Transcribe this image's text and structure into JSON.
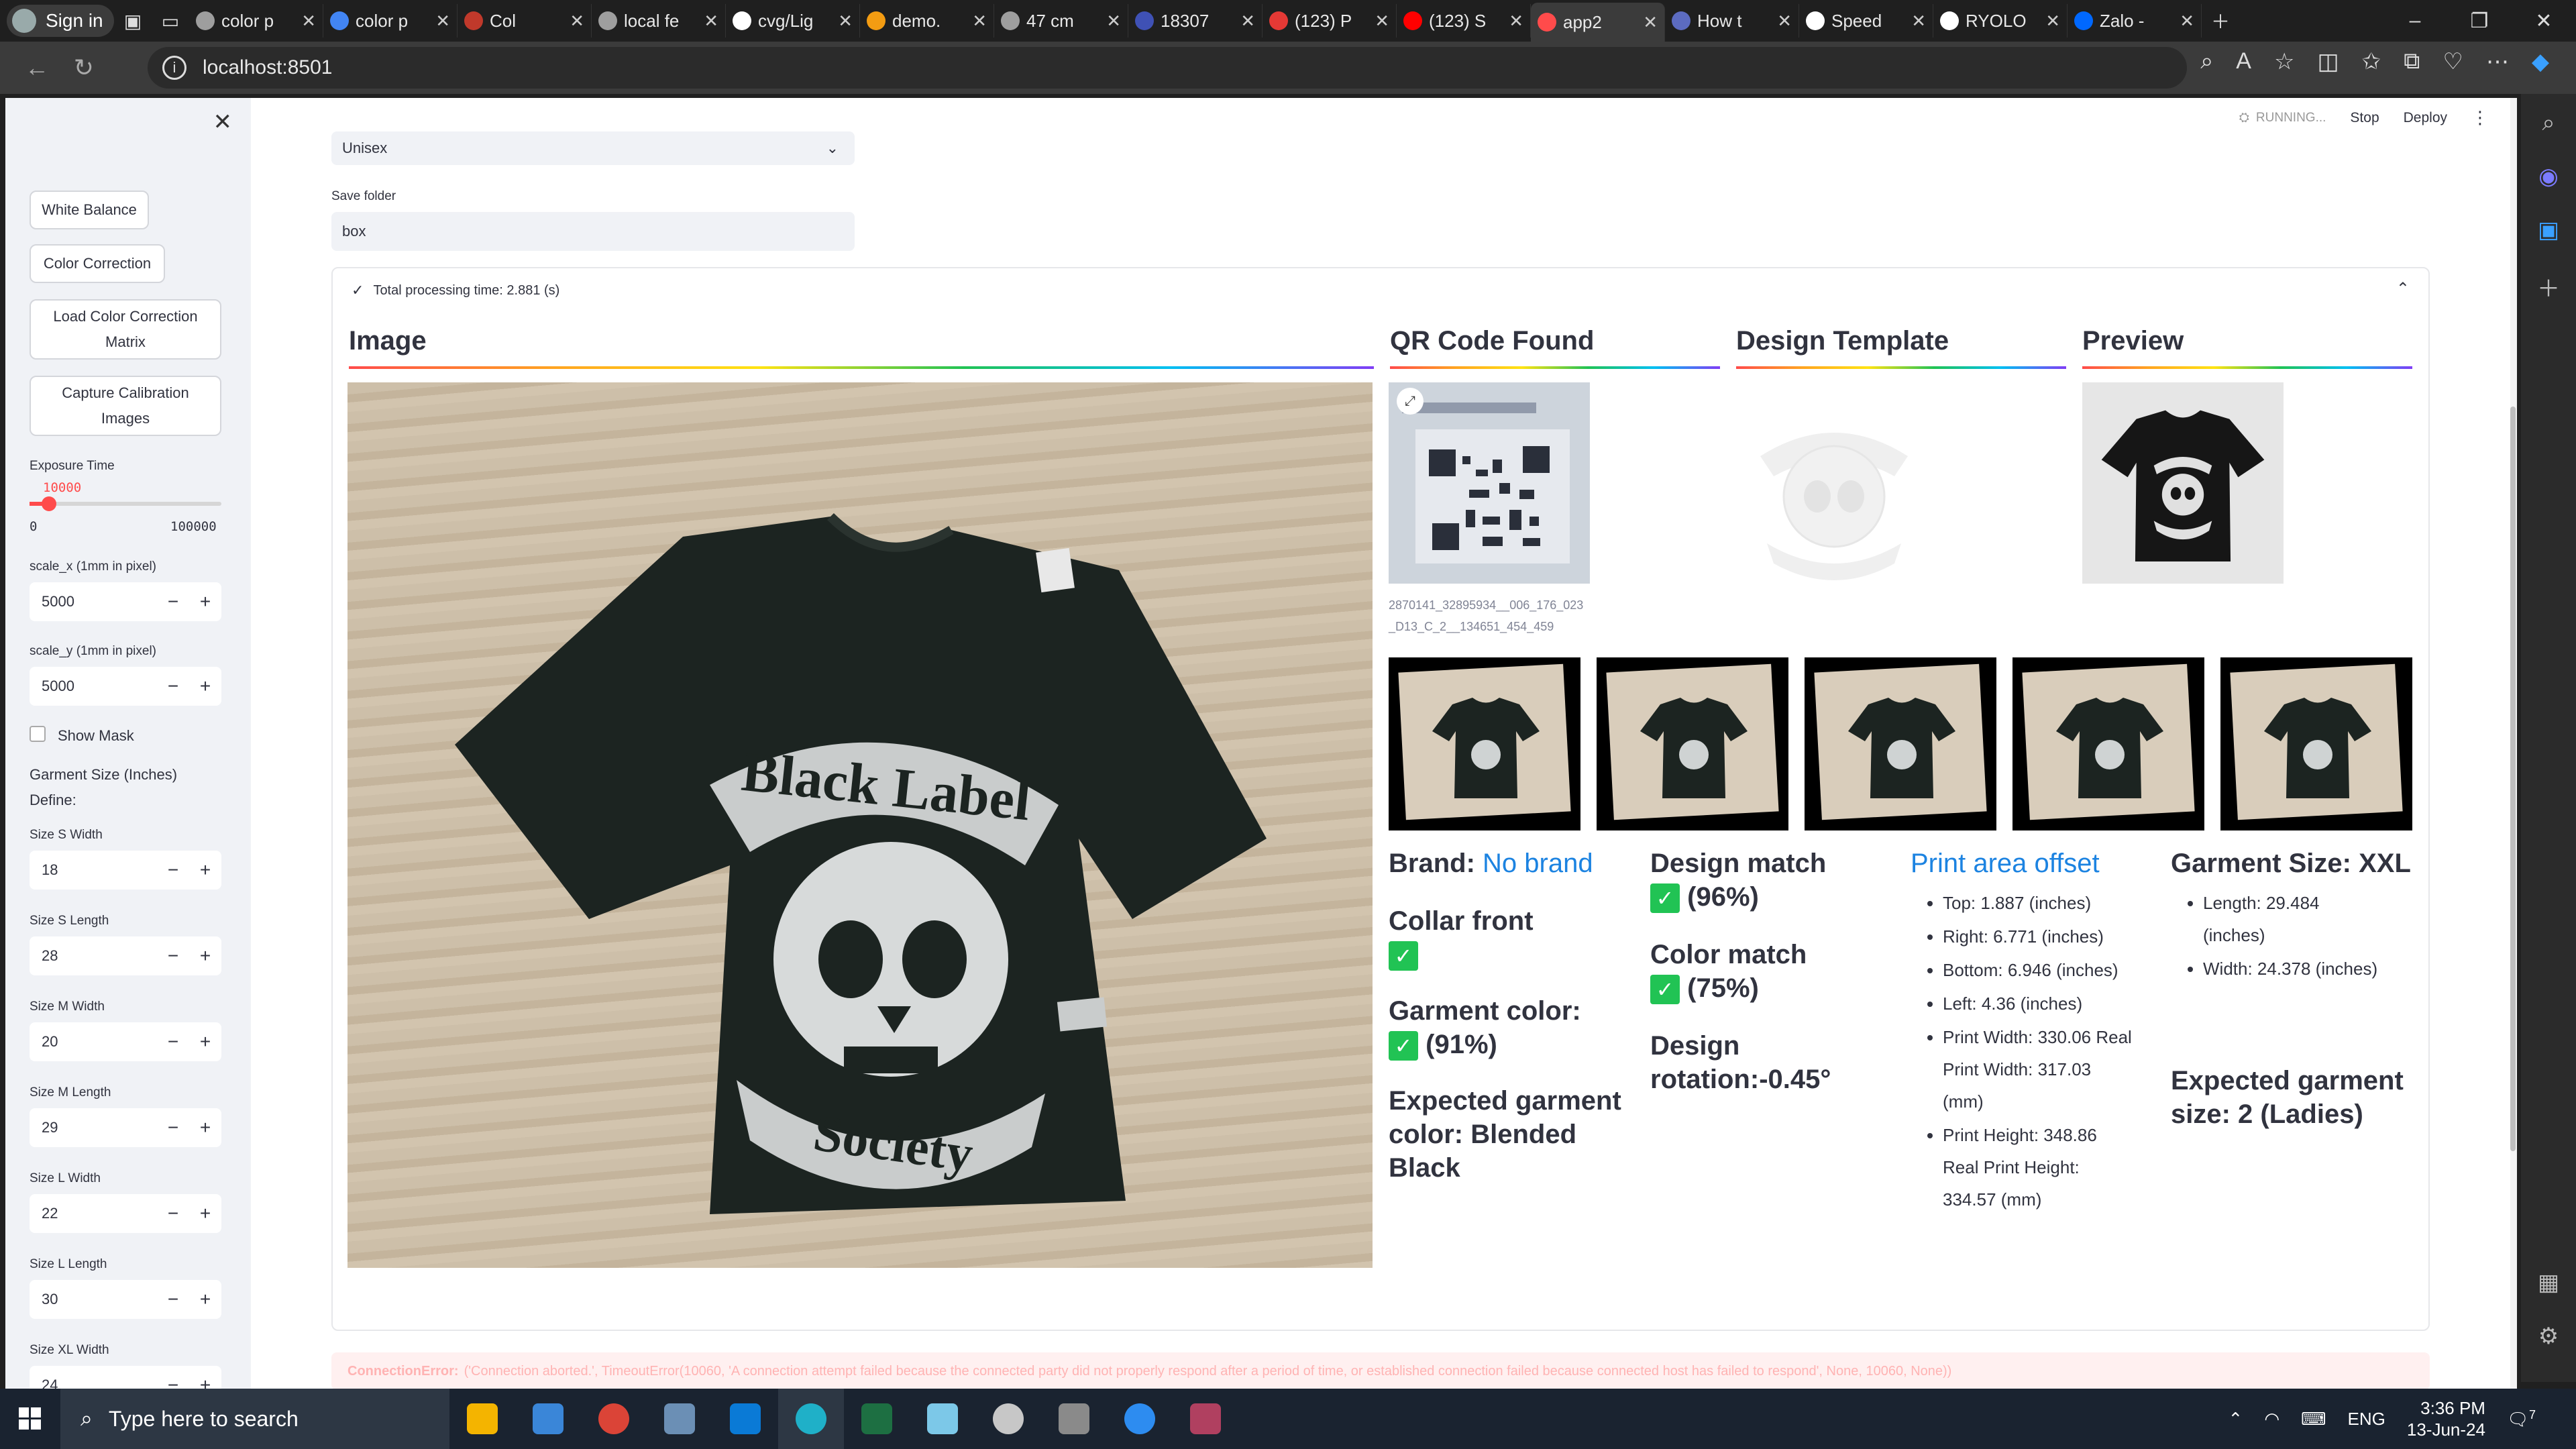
{
  "browser": {
    "profile_label": "Sign in",
    "tabs": [
      {
        "title": "color p",
        "color": "#9e9e9e"
      },
      {
        "title": "color p",
        "color": "#4285f4"
      },
      {
        "title": "Col",
        "color": "#c0392b"
      },
      {
        "title": "local fe",
        "color": "#9e9e9e"
      },
      {
        "title": "cvg/Lig",
        "color": "#ffffff"
      },
      {
        "title": "demo.",
        "color": "#f39c12"
      },
      {
        "title": "47 cm",
        "color": "#9e9e9e"
      },
      {
        "title": "18307",
        "color": "#3f51b5"
      },
      {
        "title": "(123) P",
        "color": "#e53935"
      },
      {
        "title": "(123) S",
        "color": "#ff0000"
      },
      {
        "title": "app2",
        "color": "#ff4b4b"
      },
      {
        "title": "How t",
        "color": "#5c6bc0"
      },
      {
        "title": "Speed",
        "color": "#ffffff"
      },
      {
        "title": "RYOLO",
        "color": "#ffffff"
      },
      {
        "title": "Zalo -",
        "color": "#0068ff"
      }
    ],
    "active_tab_index": 10,
    "url": "localhost:8501"
  },
  "sidebar": {
    "buttons": {
      "white_balance": "White Balance",
      "color_correction": "Color Correction",
      "load_ccm": "Load Color Correction Matrix",
      "capture_calib": "Capture Calibration Images"
    },
    "exposure": {
      "label": "Exposure Time",
      "value": "10000",
      "min": "0",
      "max": "100000",
      "fraction": 0.1
    },
    "scale_x": {
      "label": "scale_x (1mm in pixel)",
      "value": "5000"
    },
    "scale_y": {
      "label": "scale_y (1mm in pixel)",
      "value": "5000"
    },
    "show_mask": "Show Mask",
    "garment_size_heading": "Garment Size (Inches)",
    "define_label": "Define:",
    "sizes": [
      {
        "label": "Size S Width",
        "value": "18"
      },
      {
        "label": "Size S Length",
        "value": "28"
      },
      {
        "label": "Size M Width",
        "value": "20"
      },
      {
        "label": "Size M Length",
        "value": "29"
      },
      {
        "label": "Size L Width",
        "value": "22"
      },
      {
        "label": "Size L Length",
        "value": "30"
      },
      {
        "label": "Size XL Width",
        "value": "24"
      }
    ]
  },
  "header": {
    "running": "RUNNING...",
    "stop": "Stop",
    "deploy": "Deploy"
  },
  "main": {
    "gender_value": "Unisex",
    "save_folder_label": "Save folder",
    "save_folder_value": "box",
    "expander_title": "Total processing time: 2.881 (s)",
    "col_titles": {
      "image": "Image",
      "qr": "QR Code Found",
      "template": "Design Template",
      "preview": "Preview"
    },
    "qr_caption": "2870141_32895934__006_176_023_D13_C_2__134651_454_459",
    "brand_label": "Brand:",
    "brand_value": "No brand",
    "collar": "Collar front",
    "garment_color_label": "Garment color:",
    "garment_color_pct": "(91%)",
    "expected_color": "Expected garment color: Blended Black",
    "design_match_label": "Design match",
    "design_match_pct": "(96%)",
    "color_match_label": "Color match",
    "color_match_pct": "(75%)",
    "design_rotation": "Design rotation:-0.45°",
    "print_area_title": "Print area offset",
    "print_area": [
      "Top: 1.887 (inches)",
      "Right: 6.771 (inches)",
      "Bottom: 6.946 (inches)",
      "Left: 4.36 (inches)",
      "Print Width: 330.06 Real Print Width: 317.03 (mm)",
      "Print Height: 348.86 Real Print Height: 334.57 (mm)"
    ],
    "garment_size_title": "Garment Size: XXL",
    "garment_size_items": [
      "Length: 29.484 (inches)",
      "Width: 24.378 (inches)"
    ],
    "expected_size": "Expected garment size: 2 (Ladies)",
    "shirt_text_top": "Black Label",
    "shirt_text_bottom": "Society",
    "error_label": "ConnectionError:",
    "error_text": "('Connection aborted.', TimeoutError(10060, 'A connection attempt failed because the connected party did not properly respond after a period of time, or established connection failed because connected host has failed to respond', None, 10060, None))"
  },
  "taskbar": {
    "search_placeholder": "Type here to search",
    "lang": "ENG",
    "time": "3:36 PM",
    "date": "13-Jun-24",
    "notifications": "7"
  }
}
